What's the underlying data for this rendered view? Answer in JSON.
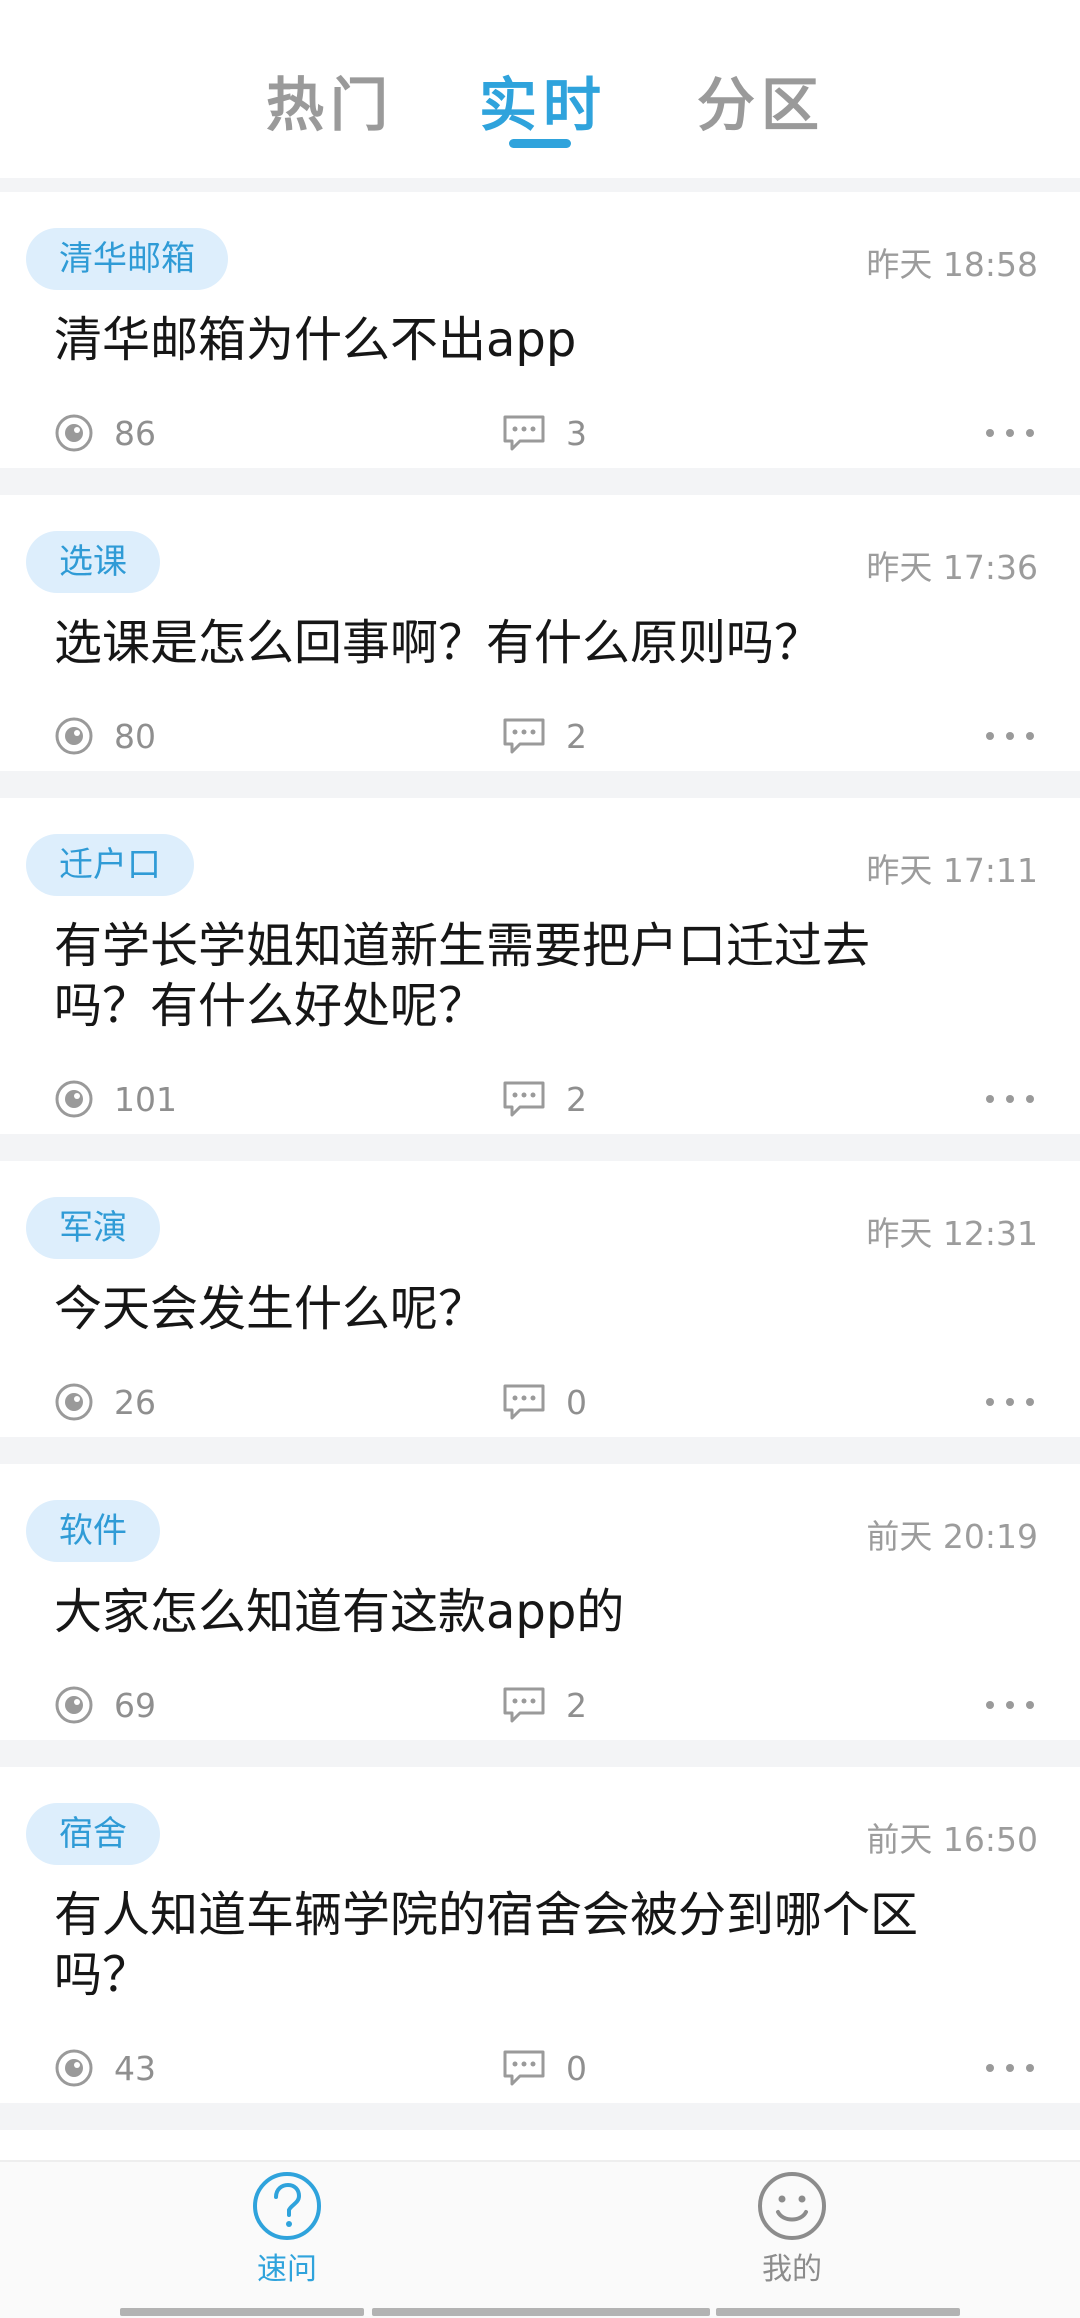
{
  "tabs": [
    {
      "label": "热门",
      "active": false
    },
    {
      "label": "实时",
      "active": true
    },
    {
      "label": "分区",
      "active": false
    }
  ],
  "posts": [
    {
      "tag": "清华邮箱",
      "time": "昨天 18:58",
      "title": "清华邮箱为什么不出app",
      "views": "86",
      "comments": "3"
    },
    {
      "tag": "选课",
      "time": "昨天 17:36",
      "title": "选课是怎么回事啊？有什么原则吗？",
      "views": "80",
      "comments": "2"
    },
    {
      "tag": "迁户口",
      "time": "昨天 17:11",
      "title": "有学长学姐知道新生需要把户口迁过去吗？有什么好处呢？",
      "views": "101",
      "comments": "2"
    },
    {
      "tag": "军演",
      "time": "昨天 12:31",
      "title": "今天会发生什么呢？",
      "views": "26",
      "comments": "0"
    },
    {
      "tag": "软件",
      "time": "前天 20:19",
      "title": "大家怎么知道有这款app的",
      "views": "69",
      "comments": "2"
    },
    {
      "tag": "宿舍",
      "time": "前天 16:50",
      "title": "有人知道车辆学院的宿舍会被分到哪个区吗？",
      "views": "43",
      "comments": "0"
    }
  ],
  "bottom_nav": [
    {
      "label": "速问",
      "icon": "question-circle-icon",
      "active": true
    },
    {
      "label": "我的",
      "icon": "smiley-face-icon",
      "active": false
    }
  ],
  "colors": {
    "accent": "#2fa3dc",
    "tag_bg": "#ddeefc",
    "muted": "#9c9c9c"
  }
}
